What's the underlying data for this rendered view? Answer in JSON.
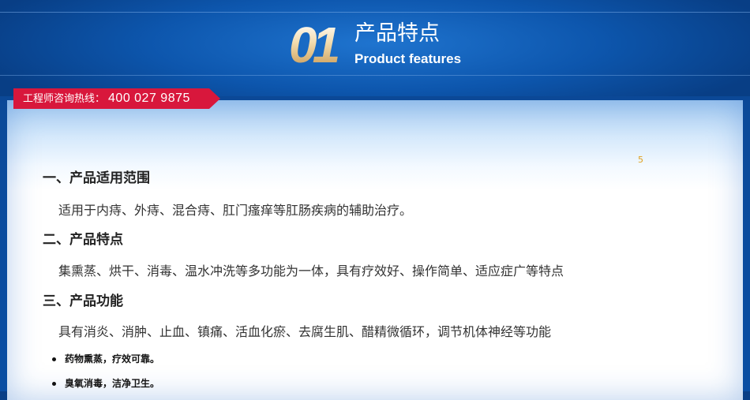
{
  "header": {
    "number": "01",
    "title_cn": "产品特点",
    "title_en": "Product features"
  },
  "hotline": {
    "label": "工程师咨询热线：",
    "number": "400 027 9875"
  },
  "stray_mark": "5",
  "sections": [
    {
      "heading": "一、产品适用范围",
      "text": "适用于内痔、外痔、混合痔、肛门瘙痒等肛肠疾病的辅助治疗。"
    },
    {
      "heading": "二、产品特点",
      "text": "集熏蒸、烘干、消毒、温水冲洗等多功能为一体，具有疗效好、操作简单、适应症广等特点"
    },
    {
      "heading": "三、产品功能",
      "text": "具有消炎、消肿、止血、镇痛、活血化瘀、去腐生肌、醋精微循环，调节机体神经等功能"
    }
  ],
  "bullets": [
    "药物熏蒸，疗效可靠。",
    "臭氧消毒，洁净卫生。"
  ],
  "colors": {
    "background_blue": "#0b4a9a",
    "hotline_red": "#d8173c",
    "number_gold": "#e9c98e"
  }
}
